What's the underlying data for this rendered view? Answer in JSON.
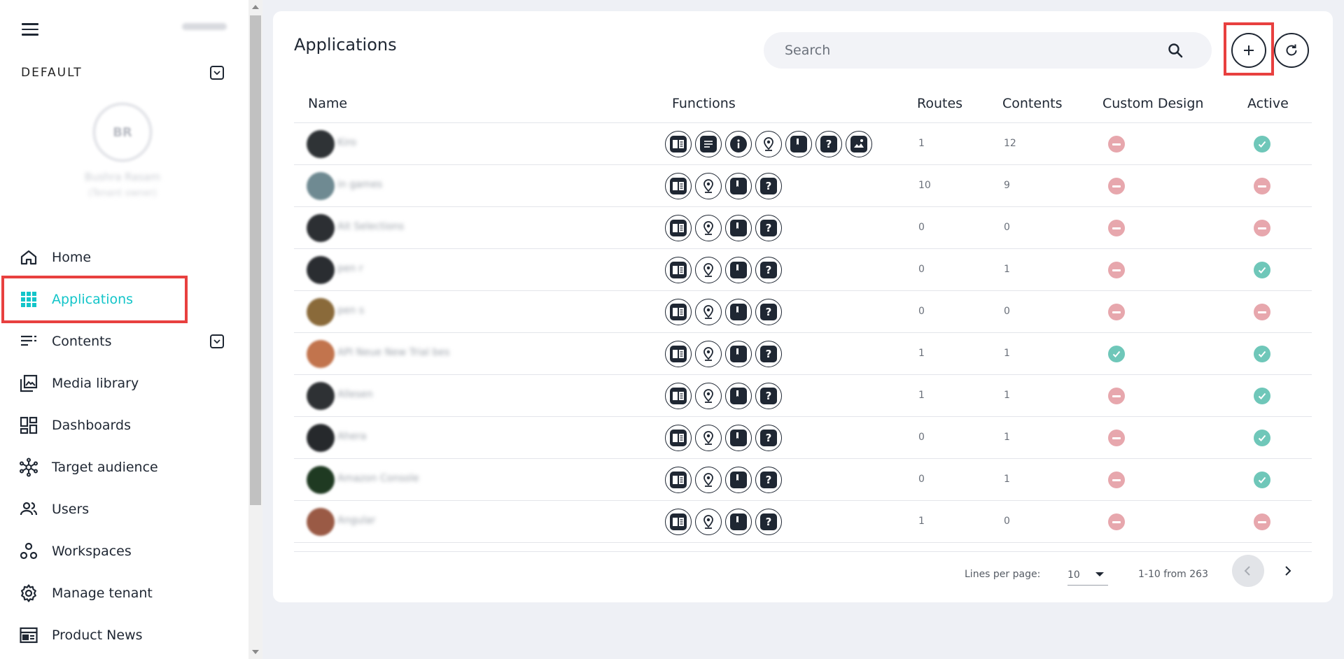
{
  "sidebar": {
    "workspace_label": "DEFAULT",
    "avatar_initials": "BR",
    "user_name": "Bushra Rasam",
    "user_role": "(Tenant owner)",
    "items": [
      {
        "label": "Home",
        "icon": "home-icon"
      },
      {
        "label": "Applications",
        "icon": "grid-icon"
      },
      {
        "label": "Contents",
        "icon": "list-icon"
      },
      {
        "label": "Media library",
        "icon": "media-icon"
      },
      {
        "label": "Dashboards",
        "icon": "dashboard-icon"
      },
      {
        "label": "Target audience",
        "icon": "network-icon"
      },
      {
        "label": "Users",
        "icon": "users-icon"
      },
      {
        "label": "Workspaces",
        "icon": "workspaces-icon"
      },
      {
        "label": "Manage tenant",
        "icon": "gear-icon"
      },
      {
        "label": "Product News",
        "icon": "news-icon"
      }
    ]
  },
  "main": {
    "title": "Applications",
    "search_placeholder": "Search",
    "columns": [
      "Name",
      "Functions",
      "Routes",
      "Contents",
      "Custom Design",
      "Active"
    ],
    "rows": [
      {
        "name": "Kiro",
        "avatar_color": "#2f3336",
        "functions": [
          "book",
          "chat",
          "info",
          "location",
          "bookmark",
          "help",
          "image"
        ],
        "routes": "1",
        "contents": "12",
        "custom_design": false,
        "active": true
      },
      {
        "name": "in games",
        "avatar_color": "#6f8a92",
        "functions": [
          "book",
          "location",
          "bookmark",
          "help"
        ],
        "routes": "10",
        "contents": "9",
        "custom_design": false,
        "active": false
      },
      {
        "name": "Ait Selections",
        "avatar_color": "#2c2f33",
        "functions": [
          "book",
          "location",
          "bookmark",
          "help"
        ],
        "routes": "0",
        "contents": "0",
        "custom_design": false,
        "active": false
      },
      {
        "name": "pen r",
        "avatar_color": "#2a2d31",
        "functions": [
          "book",
          "location",
          "bookmark",
          "help"
        ],
        "routes": "0",
        "contents": "1",
        "custom_design": false,
        "active": true
      },
      {
        "name": "pen s",
        "avatar_color": "#8a6a3a",
        "functions": [
          "book",
          "location",
          "bookmark",
          "help"
        ],
        "routes": "0",
        "contents": "0",
        "custom_design": false,
        "active": false
      },
      {
        "name": "API Neue New Trial bes",
        "avatar_color": "#c2744d",
        "functions": [
          "book",
          "location",
          "bookmark",
          "help"
        ],
        "routes": "1",
        "contents": "1",
        "custom_design": true,
        "active": true
      },
      {
        "name": "Allesen",
        "avatar_color": "#2e3134",
        "functions": [
          "book",
          "location",
          "bookmark",
          "help"
        ],
        "routes": "1",
        "contents": "1",
        "custom_design": false,
        "active": true
      },
      {
        "name": "Ahera",
        "avatar_color": "#26292c",
        "functions": [
          "book",
          "location",
          "bookmark",
          "help"
        ],
        "routes": "0",
        "contents": "1",
        "custom_design": false,
        "active": true
      },
      {
        "name": "Amazon Console",
        "avatar_color": "#1f3a22",
        "functions": [
          "book",
          "location",
          "bookmark",
          "help"
        ],
        "routes": "0",
        "contents": "1",
        "custom_design": false,
        "active": true
      },
      {
        "name": "Angular",
        "avatar_color": "#9a5a45",
        "functions": [
          "book",
          "location",
          "bookmark",
          "help"
        ],
        "routes": "1",
        "contents": "0",
        "custom_design": false,
        "active": false
      }
    ]
  },
  "pagination": {
    "lines_per_page_label": "Lines per page:",
    "lines_per_page_value": "10",
    "range_text": "1-10 from 263"
  },
  "colors": {
    "accent": "#13c5c9",
    "highlight_box": "#e8403f",
    "status_no": "#e7a7ad",
    "status_yes": "#6fc7b9"
  }
}
